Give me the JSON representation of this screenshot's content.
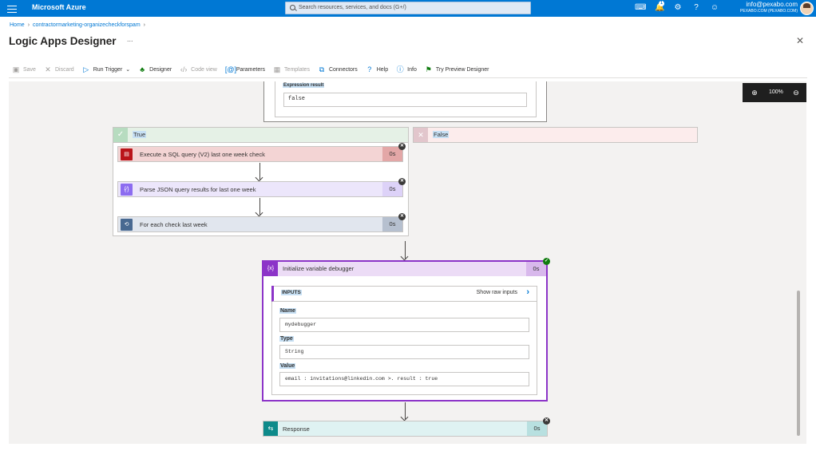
{
  "app": {
    "brand": "Microsoft Azure",
    "search_placeholder": "Search resources, services, and docs (G+/)",
    "notification_count": "1",
    "user_email": "info@pexabo.com",
    "user_org": "PEXABO.COM (PEXABO.COM)"
  },
  "breadcrumb": {
    "home": "Home",
    "resource": "contractormarketing-organizecheckforspam"
  },
  "page": {
    "title": "Logic Apps Designer",
    "more": "...",
    "close": "✕"
  },
  "toolbar": {
    "save": "Save",
    "discard": "Discard",
    "run_trigger": "Run Trigger",
    "designer": "Designer",
    "code_view": "Code view",
    "parameters": "Parameters",
    "templates": "Templates",
    "connectors": "Connectors",
    "help": "Help",
    "info": "Info",
    "try_preview": "Try Preview Designer"
  },
  "zoom": {
    "level": "100%"
  },
  "condition": {
    "expression_label": "Expression result",
    "expression_value": "false"
  },
  "branches": {
    "true_label": "True",
    "false_label": "False"
  },
  "actions": {
    "sql": {
      "title": "Execute a SQL query (V2) last one week check",
      "duration": "0s"
    },
    "json": {
      "title": "Parse JSON query results for last one week",
      "duration": "0s"
    },
    "foreach": {
      "title": "For each check last week",
      "duration": "0s"
    },
    "variable": {
      "title": "Initialize variable debugger",
      "duration": "0s"
    },
    "response": {
      "title": "Response",
      "duration": "0s"
    }
  },
  "inputs": {
    "header": "INPUTS",
    "show_raw": "Show raw inputs",
    "name_label": "Name",
    "name_value": "mydebugger",
    "type_label": "Type",
    "type_value": "String",
    "value_label": "Value",
    "value_value": "email : invitations@linkedin.com >. result : true"
  },
  "colors": {
    "azure_blue": "#0078d4",
    "variable_purple": "#8c34c8",
    "sql_red": "#ba141a",
    "success_green": "#107c10"
  }
}
